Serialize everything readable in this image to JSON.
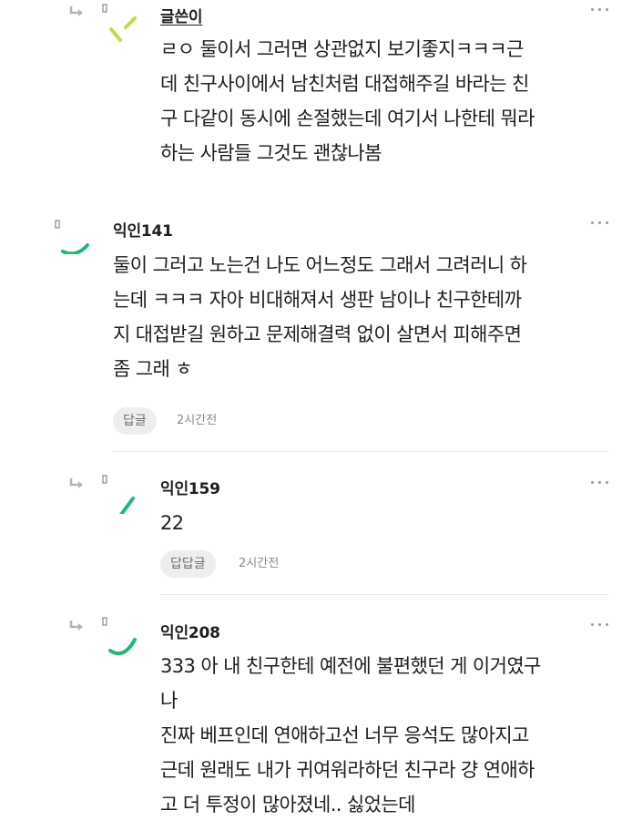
{
  "comments": [
    {
      "author": "글쓴이",
      "lines": [
        "ㄹㅇ 둘이서 그러면 상관없지 보기좋지ㅋㅋㅋ근",
        "데 친구사이에서 남친처럼 대접해주길 바라는 친",
        "구 다같이 동시에 손절했는데 여기서 나한테 뭐라",
        "하는 사람들 그것도 괜찮나봄"
      ]
    },
    {
      "author": "익인141",
      "lines": [
        "둘이 그러고 노는건 나도 어느정도 그래서 그려러니 하",
        "는데 ㅋㅋㅋ 자아 비대해져서 생판 남이나 친구한테까",
        "지 대접받길 원하고 문제해결력 없이 살면서 피해주면",
        "좀 그래 ㅎ"
      ],
      "reply_label": "답글",
      "time": "2시간전"
    },
    {
      "author": "익인159",
      "lines": [
        "22"
      ],
      "reply_label": "답답글",
      "time": "2시간전"
    },
    {
      "author": "익인208",
      "lines": [
        "333 아 내 친구한테 예전에 불편했던 게 이거였구",
        "나",
        "진짜 베프인데 연애하고선 너무 응석도 많아지고",
        "근데 원래도 내가 귀여워라하던 친구라 걍 연애하",
        "고 더 투정이 많아졌네.. 싫었는데"
      ]
    }
  ],
  "icons": {
    "reply_arrow": "reply-arrow-icon",
    "more": "more-options-icon",
    "avatar": "anonymous-avatar-icon"
  },
  "colors": {
    "accent_green": "#1fb877",
    "accent_lime": "#c8d84a",
    "reply_pill_bg": "#eeeeee"
  }
}
